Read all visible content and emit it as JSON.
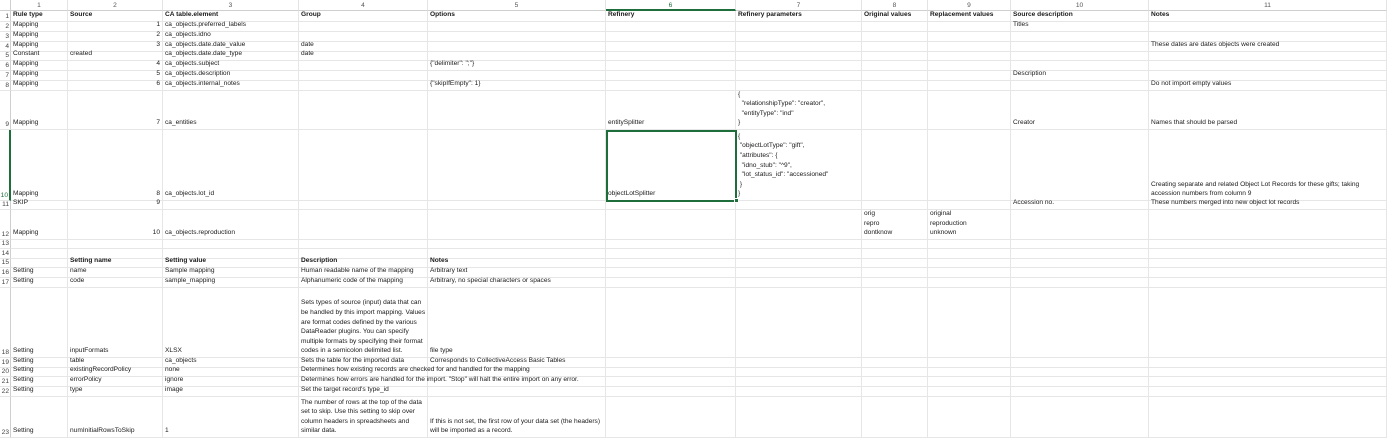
{
  "column_headers": [
    "1",
    "2",
    "3",
    "4",
    "5",
    "6",
    "7",
    "8",
    "9",
    "10",
    "11"
  ],
  "row_numbers": [
    "1",
    "2",
    "3",
    "4",
    "5",
    "6",
    "7",
    "8",
    "9",
    "10",
    "11",
    "12",
    "13",
    "14",
    "15",
    "16",
    "17",
    "18",
    "19",
    "20",
    "21",
    "22",
    "23"
  ],
  "selected_cell": "R10C6",
  "rows": [
    [
      "Rule type",
      "Source",
      "CA table.element",
      "Group",
      "Options",
      "Refinery",
      "Refinery parameters",
      "Original values",
      "Replacement values",
      "Source description",
      "Notes"
    ],
    [
      "Mapping",
      "1",
      "ca_objects.preferred_labels",
      "",
      "",
      "",
      "",
      "",
      "",
      "Titles",
      ""
    ],
    [
      "Mapping",
      "2",
      "ca_objects.idno",
      "",
      "",
      "",
      "",
      "",
      "",
      "",
      ""
    ],
    [
      "Mapping",
      "3",
      "ca_objects.date.date_value",
      "date",
      "",
      "",
      "",
      "",
      "",
      "",
      "These dates are dates objects were created"
    ],
    [
      "Constant",
      "created",
      "ca_objects.date.date_type",
      "date",
      "",
      "",
      "",
      "",
      "",
      "",
      ""
    ],
    [
      "Mapping",
      "4",
      "ca_objects.subject",
      "",
      "{\"delimiter\": \";\"}",
      "",
      "",
      "",
      "",
      "",
      ""
    ],
    [
      "Mapping",
      "5",
      "ca_objects.description",
      "",
      "",
      "",
      "",
      "",
      "",
      "Description",
      ""
    ],
    [
      "Mapping",
      "6",
      "ca_objects.internal_notes",
      "",
      "{\"skipIfEmpty\": 1}",
      "",
      "",
      "",
      "",
      "",
      "Do not import empty values"
    ],
    [
      "Mapping",
      "7",
      "ca_entities",
      "",
      "",
      "entitySplitter",
      "{\n  \"relationshipType\": \"creator\",\n  \"entityType\": \"ind\"\n}",
      "",
      "",
      "Creator",
      "Names that should be parsed"
    ],
    [
      "Mapping",
      "8",
      "ca_objects.lot_id",
      "",
      "",
      "objectLotSplitter",
      "{\n \"objectLotType\": \"gift\",\n \"attributes\": {\n  \"idno_stub\": \"^9\",\n  \"lot_status_id\": \"accessioned\"\n }\n}",
      "",
      "",
      "",
      "Creating separate and related Object Lot Records for these gifts; taking\naccession numbers from column 9"
    ],
    [
      "SKIP",
      "9",
      "",
      "",
      "",
      "",
      "",
      "",
      "",
      "Accession no.",
      "These numbers merged into new object lot records"
    ],
    [
      "Mapping",
      "10",
      "ca_objects.reproduction",
      "",
      "",
      "",
      "",
      "orig\nrepro\ndontknow",
      "original\nreproduction\nunknown",
      "",
      ""
    ],
    [
      "",
      "",
      "",
      "",
      "",
      "",
      "",
      "",
      "",
      "",
      ""
    ],
    [
      "",
      "",
      "",
      "",
      "",
      "",
      "",
      "",
      "",
      "",
      ""
    ],
    [
      "",
      "Setting name",
      "Setting value",
      "Description",
      "Notes",
      "",
      "",
      "",
      "",
      "",
      ""
    ],
    [
      "Setting",
      "name",
      "Sample mapping",
      "Human readable name of the mapping",
      "Arbitrary text",
      "",
      "",
      "",
      "",
      "",
      ""
    ],
    [
      "Setting",
      "code",
      "sample_mapping",
      "Alphanumeric code of the mapping",
      "Arbitrary, no special characters or spaces",
      "",
      "",
      "",
      "",
      "",
      ""
    ],
    [
      "Setting",
      "inputFormats",
      "XLSX",
      "Sets types of source (input) data that can\nbe handled by this import mapping. Values\nare format codes defined by the various\nDataReader plugins. You can specify\nmultiple formats by specifying their format\ncodes in a semicolon delimited list.",
      "file type",
      "",
      "",
      "",
      "",
      "",
      ""
    ],
    [
      "Setting",
      "table",
      "ca_objects",
      "Sets the table for the imported data",
      "Corresponds to CollectiveAccess Basic Tables",
      "",
      "",
      "",
      "",
      "",
      ""
    ],
    [
      "Setting",
      "existingRecordPolicy",
      "none",
      "Determines how existing records are checked for and handled for the mapping",
      "",
      "",
      "",
      "",
      "",
      "",
      ""
    ],
    [
      "Setting",
      "errorPolicy",
      "ignore",
      "Determines how errors are handled for the import. \"Stop\" will halt the entire import on any error.",
      "",
      "",
      "",
      "",
      "",
      "",
      ""
    ],
    [
      "Setting",
      "type",
      "image",
      "Set the target record's type_id",
      "",
      "",
      "",
      "",
      "",
      "",
      ""
    ],
    [
      "Setting",
      "numInitialRowsToSkip",
      "1",
      "The number of rows at the top of the data\nset to skip. Use this setting to skip over\ncolumn headers in spreadsheets and\nsimilar data.",
      "If this is not set, the first row of your data set (the headers)\nwill be imported as a record.",
      "",
      "",
      "",
      "",
      "",
      ""
    ]
  ],
  "colors": {
    "accent": "#1e6e3c",
    "grid": "#e6e6e6",
    "header_text": "#555555"
  }
}
